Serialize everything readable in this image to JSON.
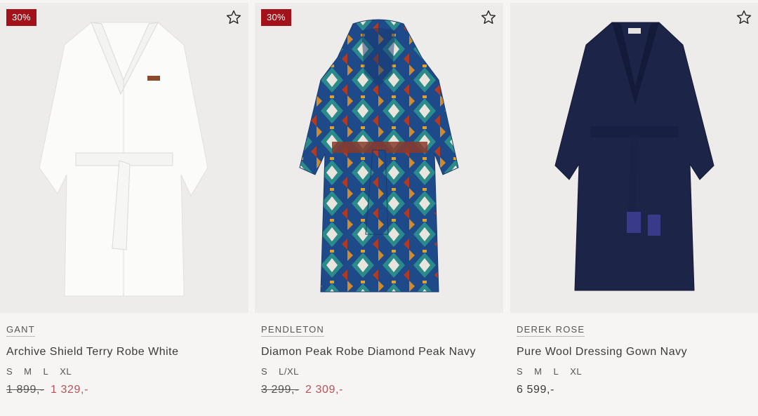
{
  "colors": {
    "badge": "#a3121a",
    "sale_price": "#b5525a",
    "background": "#f6f5f3"
  },
  "products": [
    {
      "badge": "30%",
      "brand": "GANT",
      "name": "Archive Shield Terry Robe White",
      "sizes": [
        "S",
        "M",
        "L",
        "XL"
      ],
      "old_price": "1 899,-",
      "price": "1 329,-",
      "icon": "star-outline-icon"
    },
    {
      "badge": "30%",
      "brand": "PENDLETON",
      "name": "Diamon Peak Robe Diamond Peak Navy",
      "sizes": [
        "S",
        "L/XL"
      ],
      "old_price": "3 299,-",
      "price": "2 309,-",
      "icon": "star-outline-icon"
    },
    {
      "brand": "DEREK ROSE",
      "name": "Pure Wool Dressing Gown Navy",
      "sizes": [
        "S",
        "M",
        "L",
        "XL"
      ],
      "price": "6 599,-",
      "icon": "star-outline-icon"
    }
  ]
}
